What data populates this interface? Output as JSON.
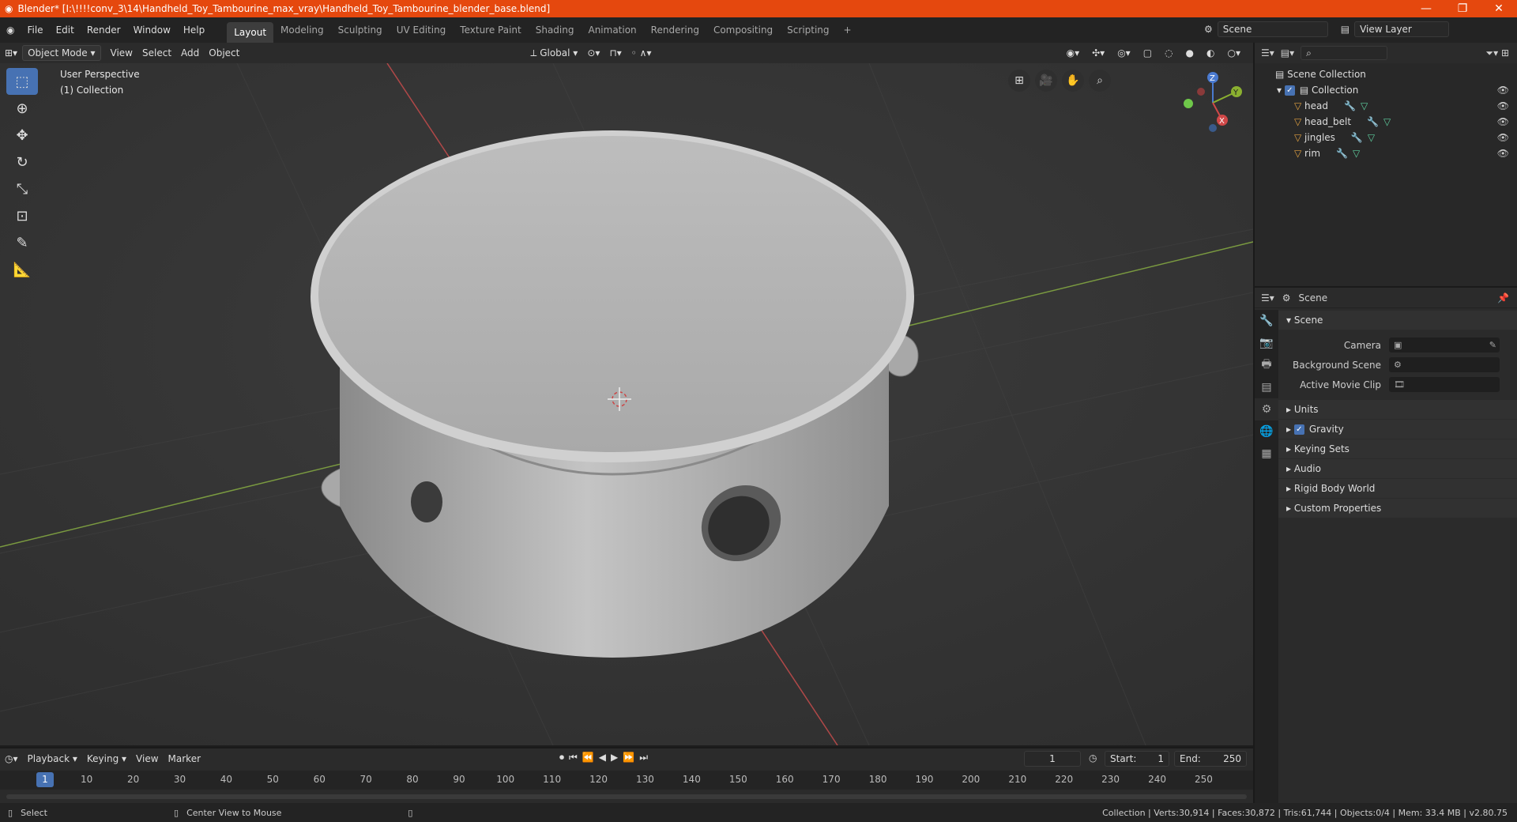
{
  "window": {
    "title": "Blender* [I:\\!!!!conv_3\\14\\Handheld_Toy_Tambourine_max_vray\\Handheld_Toy_Tambourine_blender_base.blend]",
    "min": "—",
    "max": "❐",
    "close": "✕"
  },
  "menu": [
    "File",
    "Edit",
    "Render",
    "Window",
    "Help"
  ],
  "workspaces": [
    "Layout",
    "Modeling",
    "Sculpting",
    "UV Editing",
    "Texture Paint",
    "Shading",
    "Animation",
    "Rendering",
    "Compositing",
    "Scripting"
  ],
  "add_workspace": "+",
  "scene": {
    "label": "Scene",
    "view_layer": "View Layer"
  },
  "viewport": {
    "mode": "Object Mode",
    "menus": [
      "View",
      "Select",
      "Add",
      "Object"
    ],
    "transform": "Global",
    "info_line1": "User Perspective",
    "info_line2": "(1) Collection",
    "gizmo": {
      "x": "X",
      "y": "Y",
      "z": "Z"
    }
  },
  "outliner": {
    "root": "Scene Collection",
    "collection": "Collection",
    "objects": [
      "head",
      "head_belt",
      "jingles",
      "rim"
    ]
  },
  "properties": {
    "context": "Scene",
    "section": "Scene",
    "fields": [
      {
        "label": "Camera"
      },
      {
        "label": "Background Scene"
      },
      {
        "label": "Active Movie Clip"
      }
    ],
    "panels": [
      "Units",
      "Gravity",
      "Keying Sets",
      "Audio",
      "Rigid Body World",
      "Custom Properties"
    ]
  },
  "timeline": {
    "menus": [
      "Playback",
      "Keying",
      "View",
      "Marker"
    ],
    "current_frame": "1",
    "start_label": "Start:",
    "start": "1",
    "end_label": "End:",
    "end": "250",
    "ticks": [
      "10",
      "20",
      "30",
      "40",
      "50",
      "60",
      "70",
      "80",
      "90",
      "100",
      "110",
      "120",
      "130",
      "140",
      "150",
      "160",
      "170",
      "180",
      "190",
      "200",
      "210",
      "220",
      "230",
      "240",
      "250"
    ]
  },
  "status": {
    "select": "Select",
    "center": "Center View to Mouse",
    "stats": "Collection | Verts:30,914 | Faces:30,872 | Tris:61,744 | Objects:0/4 | Mem: 33.4 MB | v2.80.75"
  }
}
